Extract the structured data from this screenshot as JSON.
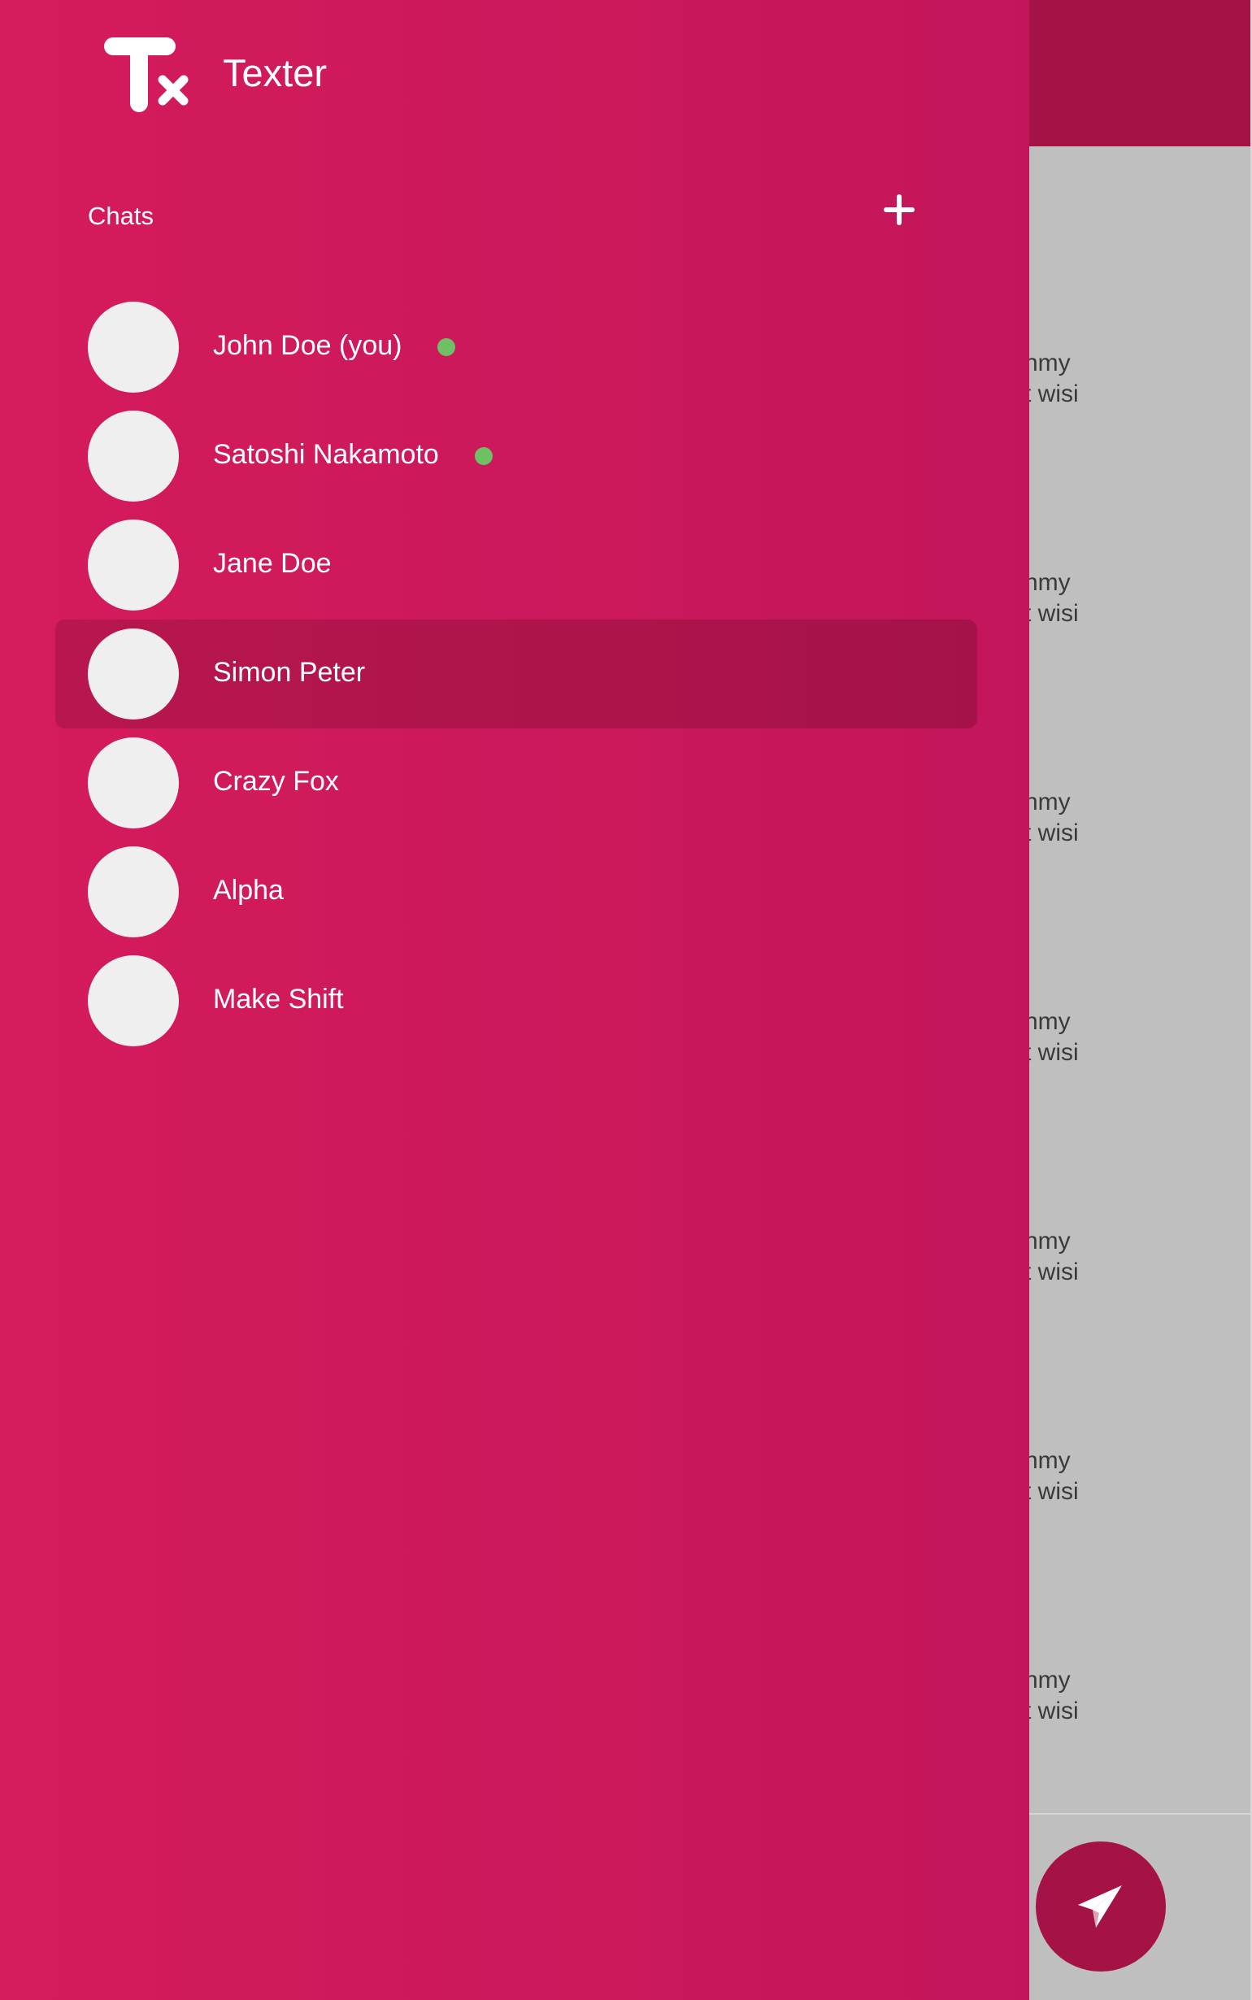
{
  "app": {
    "title": "Texter",
    "logo_text": "Tx"
  },
  "drawer": {
    "section_label": "Chats",
    "add_icon": "plus-icon",
    "chats": [
      {
        "name": "John Doe (you)",
        "online": true,
        "selected": false
      },
      {
        "name": "Satoshi Nakamoto",
        "online": true,
        "selected": false
      },
      {
        "name": "Jane Doe",
        "online": false,
        "selected": false
      },
      {
        "name": "Simon Peter",
        "online": false,
        "selected": true
      },
      {
        "name": "Crazy Fox",
        "online": false,
        "selected": false
      },
      {
        "name": "Alpha",
        "online": false,
        "selected": false
      },
      {
        "name": "Make Shift",
        "online": false,
        "selected": false
      }
    ]
  },
  "background": {
    "messages": [
      {
        "line1": "nmy",
        "line2": "t wisi"
      },
      {
        "line1": "nmy",
        "line2": "t wisi"
      },
      {
        "line1": "nmy",
        "line2": "t wisi"
      },
      {
        "line1": "nmy",
        "line2": "t wisi"
      },
      {
        "line1": "nmy",
        "line2": "t wisi"
      },
      {
        "line1": "nmy",
        "line2": "t wisi"
      },
      {
        "line1": "nmy",
        "line2": "t wisi"
      }
    ],
    "send_icon": "paper-plane-icon"
  },
  "colors": {
    "drawer_start": "#d41b5d",
    "drawer_end": "#c3165a",
    "header": "#a51346",
    "selected_row": "#a5124a",
    "online": "#6fbf64",
    "avatar": "#efefef",
    "content_bg": "#bfbfbf"
  }
}
